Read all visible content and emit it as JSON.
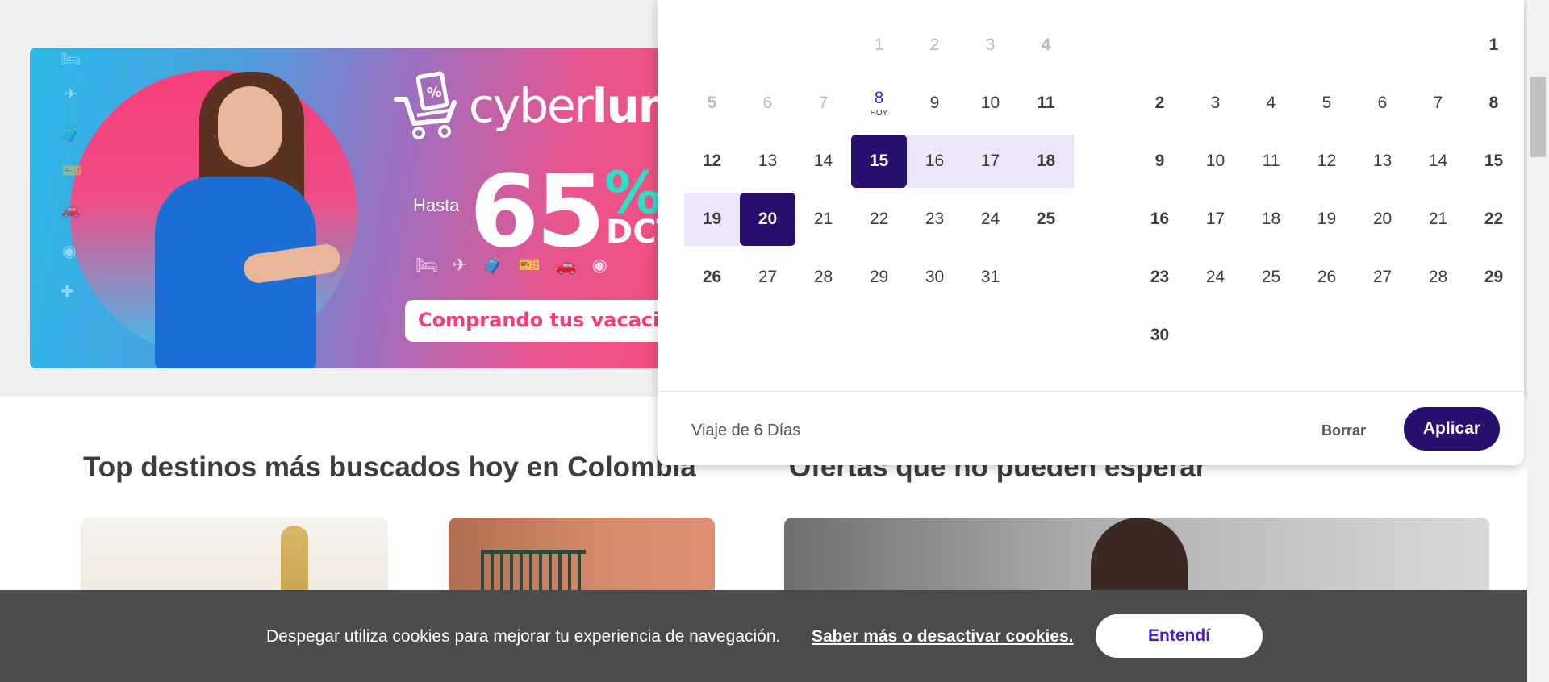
{
  "banner": {
    "brand_prefix": "cyber",
    "brand_suffix": "lun",
    "hasta": "Hasta",
    "discount_number": "65",
    "percent_sign": "%",
    "dct": "DCT",
    "cta": "Comprando tus vacacio",
    "accent_pink": "#f23d76",
    "accent_teal": "#2be0c6"
  },
  "sections": {
    "top_destinations_title": "Top destinos más buscados hoy en Colombia",
    "offers_title": "Ofertas que no pueden esperar"
  },
  "calendar": {
    "today_label": "HOY",
    "month_1": {
      "weeks": [
        [
          "",
          "",
          "",
          "1",
          "2",
          "3",
          "4"
        ],
        [
          "5",
          "6",
          "7",
          "8",
          "9",
          "10",
          "11"
        ],
        [
          "12",
          "13",
          "14",
          "15",
          "16",
          "17",
          "18"
        ],
        [
          "19",
          "20",
          "21",
          "22",
          "23",
          "24",
          "25"
        ],
        [
          "26",
          "27",
          "28",
          "29",
          "30",
          "31",
          ""
        ]
      ]
    },
    "month_2": {
      "weeks": [
        [
          "",
          "",
          "",
          "",
          "",
          "",
          "1"
        ],
        [
          "2",
          "3",
          "4",
          "5",
          "6",
          "7",
          "8"
        ],
        [
          "9",
          "10",
          "11",
          "12",
          "13",
          "14",
          "15"
        ],
        [
          "16",
          "17",
          "18",
          "19",
          "20",
          "21",
          "22"
        ],
        [
          "23",
          "24",
          "25",
          "26",
          "27",
          "28",
          "29"
        ],
        [
          "30",
          "",
          "",
          "",
          "",
          "",
          ""
        ]
      ]
    },
    "today": "8",
    "range_start": "15",
    "range_end": "20",
    "trip_length": "Viaje de 6 Días",
    "clear_label": "Borrar",
    "apply_label": "Aplicar",
    "selected_color": "#2a0f6e",
    "range_color": "#ece6f8"
  },
  "cookie_bar": {
    "message": "Despegar utiliza cookies para mejorar tu experiencia de navegación.",
    "link": "Saber más o desactivar cookies.",
    "accept_label": "Entendí"
  }
}
